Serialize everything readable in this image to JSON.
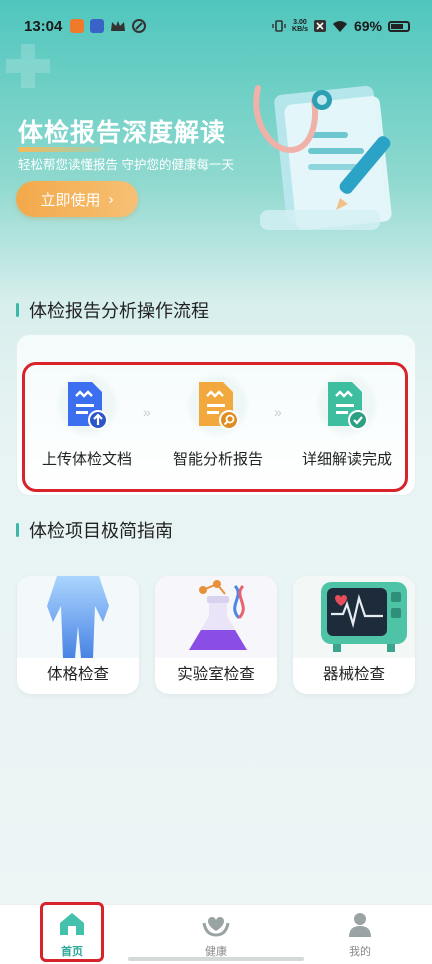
{
  "status_bar": {
    "time": "13:04",
    "net_speed_value": "3.00",
    "net_speed_unit": "KB/s",
    "battery": "69%"
  },
  "hero": {
    "title": "体检报告深度解读",
    "subtitle": "轻松帮您读懂报告  守护您的健康每一天",
    "cta_label": "立即使用",
    "cta_arrow": "›"
  },
  "process": {
    "title": "体检报告分析操作流程",
    "steps": [
      {
        "label": "上传体检文档",
        "icon": "upload-document-icon",
        "color": "#3b6ff0"
      },
      {
        "label": "智能分析报告",
        "icon": "analyze-document-icon",
        "color": "#f2a83c"
      },
      {
        "label": "详细解读完成",
        "icon": "complete-document-icon",
        "color": "#3dbf9f"
      }
    ],
    "arrow": "»"
  },
  "guide": {
    "title": "体检项目极简指南",
    "cards": [
      {
        "label": "体格检查",
        "icon": "body-figure-icon"
      },
      {
        "label": "实验室检查",
        "icon": "lab-flask-icon"
      },
      {
        "label": "器械检查",
        "icon": "monitor-icon"
      }
    ]
  },
  "nav": {
    "items": [
      {
        "label": "首页",
        "icon": "home-icon",
        "active": true
      },
      {
        "label": "健康",
        "icon": "health-hands-icon",
        "active": false
      },
      {
        "label": "我的",
        "icon": "user-icon",
        "active": false
      }
    ]
  },
  "colors": {
    "accent": "#3cb8a9",
    "cta": "#f3a94a",
    "annotation_red": "#d8232a"
  }
}
